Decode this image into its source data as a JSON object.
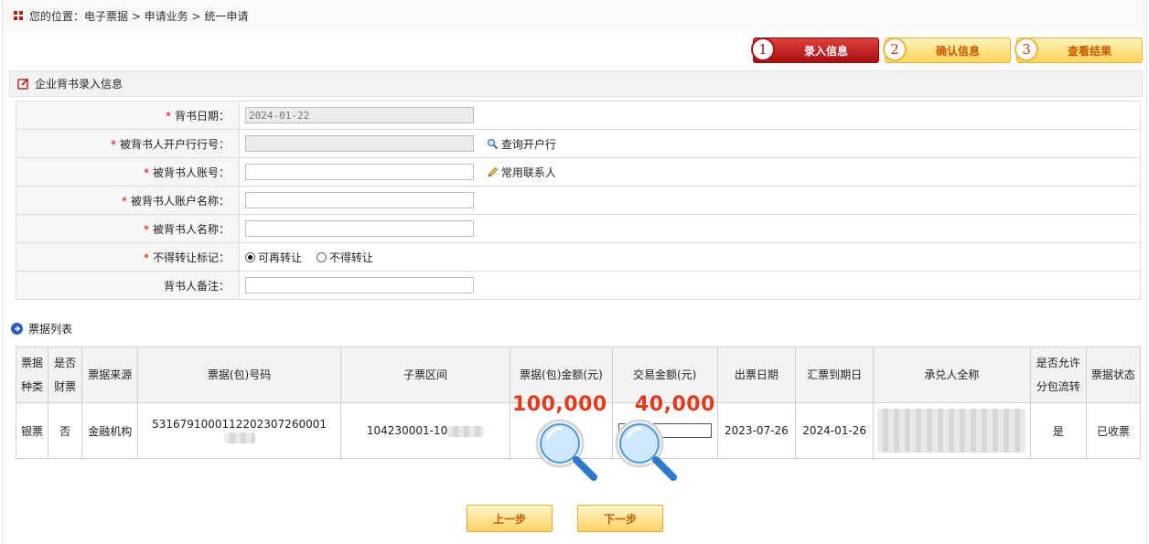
{
  "breadcrumb": {
    "text": "您的位置：电子票据 > 申请业务 > 统一申请"
  },
  "steps": [
    {
      "num": "1",
      "label": "录入信息"
    },
    {
      "num": "2",
      "label": "确认信息"
    },
    {
      "num": "3",
      "label": "查看结果"
    }
  ],
  "section": {
    "title": "企业背书录入信息"
  },
  "form": {
    "endorse_date_label": "背书日期：",
    "endorse_date_value": "2024-01-22",
    "bank_no_label": "被背书人开户行行号：",
    "bank_no_value": "",
    "query_bank_link": "查询开户行",
    "account_label": "被背书人账号：",
    "contacts_link": "常用联系人",
    "account_name_label": "被背书人账户名称：",
    "name_label": "被背书人名称：",
    "transfer_label": "不得转让标记：",
    "transfer_opt1": "可再转让",
    "transfer_opt2": "不得转让",
    "remark_label": "背书人备注：",
    "required_mark": "*"
  },
  "list": {
    "title": "票据列表",
    "headers": {
      "kind": "票据种类",
      "finance": "是否财票",
      "source": "票据来源",
      "number": "票据(包)号码",
      "range": "子票区间",
      "amount": "票据(包)金额(元)",
      "trade": "交易金额(元)",
      "issue_date": "出票日期",
      "due_date": "汇票到期日",
      "acceptor": "承兑人全称",
      "split": "是否允许分包流转",
      "status": "票据状态"
    },
    "row": {
      "kind": "银票",
      "finance": "否",
      "source": "金融机构",
      "number": "5316791000112202307260001",
      "range": "104230001-10",
      "amount": "",
      "trade": "",
      "issue_date": "2023-07-26",
      "due_date": "2024-01-26",
      "acceptor": "",
      "split": "是",
      "status": "已收票"
    },
    "overlay_amount": "100,000",
    "overlay_trade": "40,000"
  },
  "buttons": {
    "prev": "上一步",
    "next": "下一步"
  },
  "colors": {
    "accent": "#b81d1d",
    "step_yellow": "#ffd25a",
    "overlay_red": "#e5391c"
  }
}
